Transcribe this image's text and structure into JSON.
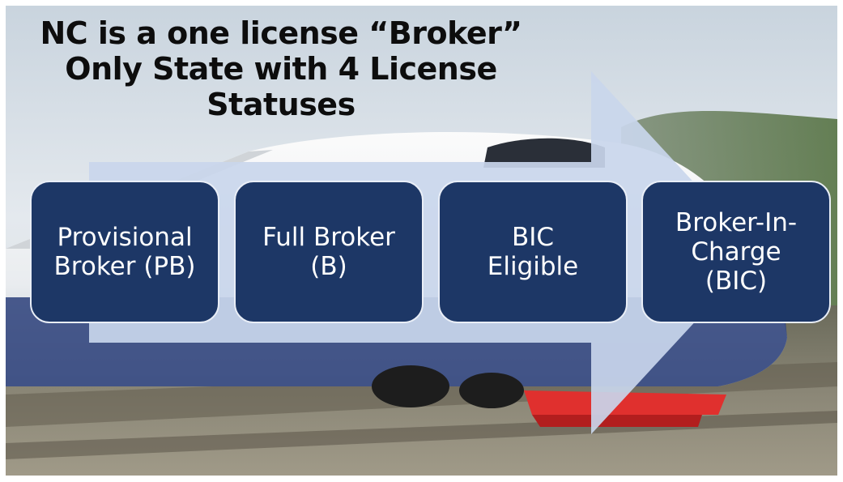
{
  "title": {
    "line1": "NC is a one license “Broker”",
    "line2": "Only State with 4 License",
    "line3": "Statuses"
  },
  "statuses": [
    {
      "line1": "Provisional",
      "line2": "Broker (PB)",
      "line3": ""
    },
    {
      "line1": "Full Broker",
      "line2": "(B)",
      "line3": ""
    },
    {
      "line1": "BIC",
      "line2": "Eligible",
      "line3": ""
    },
    {
      "line1": "Broker-In-",
      "line2": "Charge",
      "line3": "(BIC)"
    }
  ],
  "colors": {
    "box_fill": "#1d3766",
    "arrow_fill": "#c9d6ec",
    "text_light": "#ffffff",
    "title_text": "#0d0d0d"
  },
  "background_image": "high-speed-train-photo"
}
